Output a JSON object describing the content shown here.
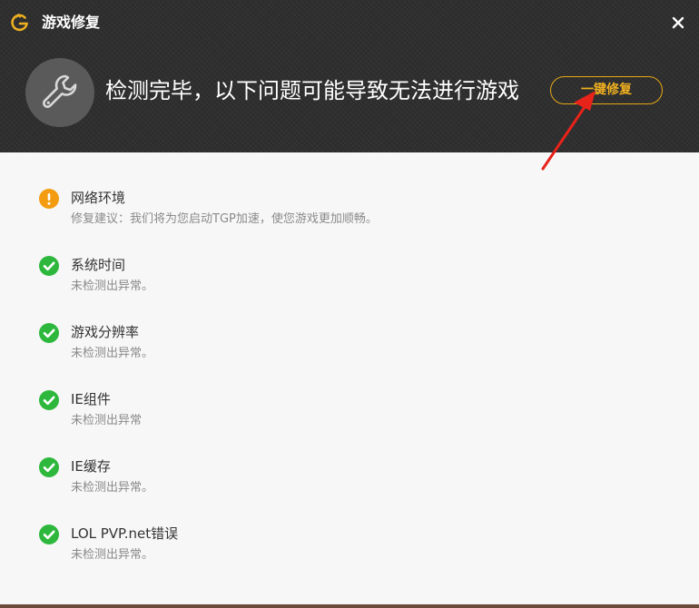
{
  "window": {
    "title": "游戏修复",
    "logo_icon": "tgp-logo-icon",
    "close_icon": "close-icon"
  },
  "header": {
    "icon": "wrench-icon",
    "message": "检测完毕，以下问题可能导致无法进行游戏",
    "fix_button_label": "一键修复"
  },
  "colors": {
    "accent": "#f0b020",
    "warning": "#f39c12",
    "ok": "#2db83d",
    "header_bg": "#2f2f2f",
    "annotation_arrow": "#e8231a"
  },
  "items": [
    {
      "title": "网络环境",
      "desc": "修复建议：我们将为您启动TGP加速，使您游戏更加顺畅。",
      "status": "warning",
      "icon": "warning-icon"
    },
    {
      "title": "系统时间",
      "desc": "未检测出异常。",
      "status": "ok",
      "icon": "check-icon"
    },
    {
      "title": "游戏分辨率",
      "desc": "未检测出异常。",
      "status": "ok",
      "icon": "check-icon"
    },
    {
      "title": "IE组件",
      "desc": "未检测出异常",
      "status": "ok",
      "icon": "check-icon"
    },
    {
      "title": "IE缓存",
      "desc": "未检测出异常。",
      "status": "ok",
      "icon": "check-icon"
    },
    {
      "title": "LOL PVP.net错误",
      "desc": "未检测出异常。",
      "status": "ok",
      "icon": "check-icon"
    }
  ]
}
